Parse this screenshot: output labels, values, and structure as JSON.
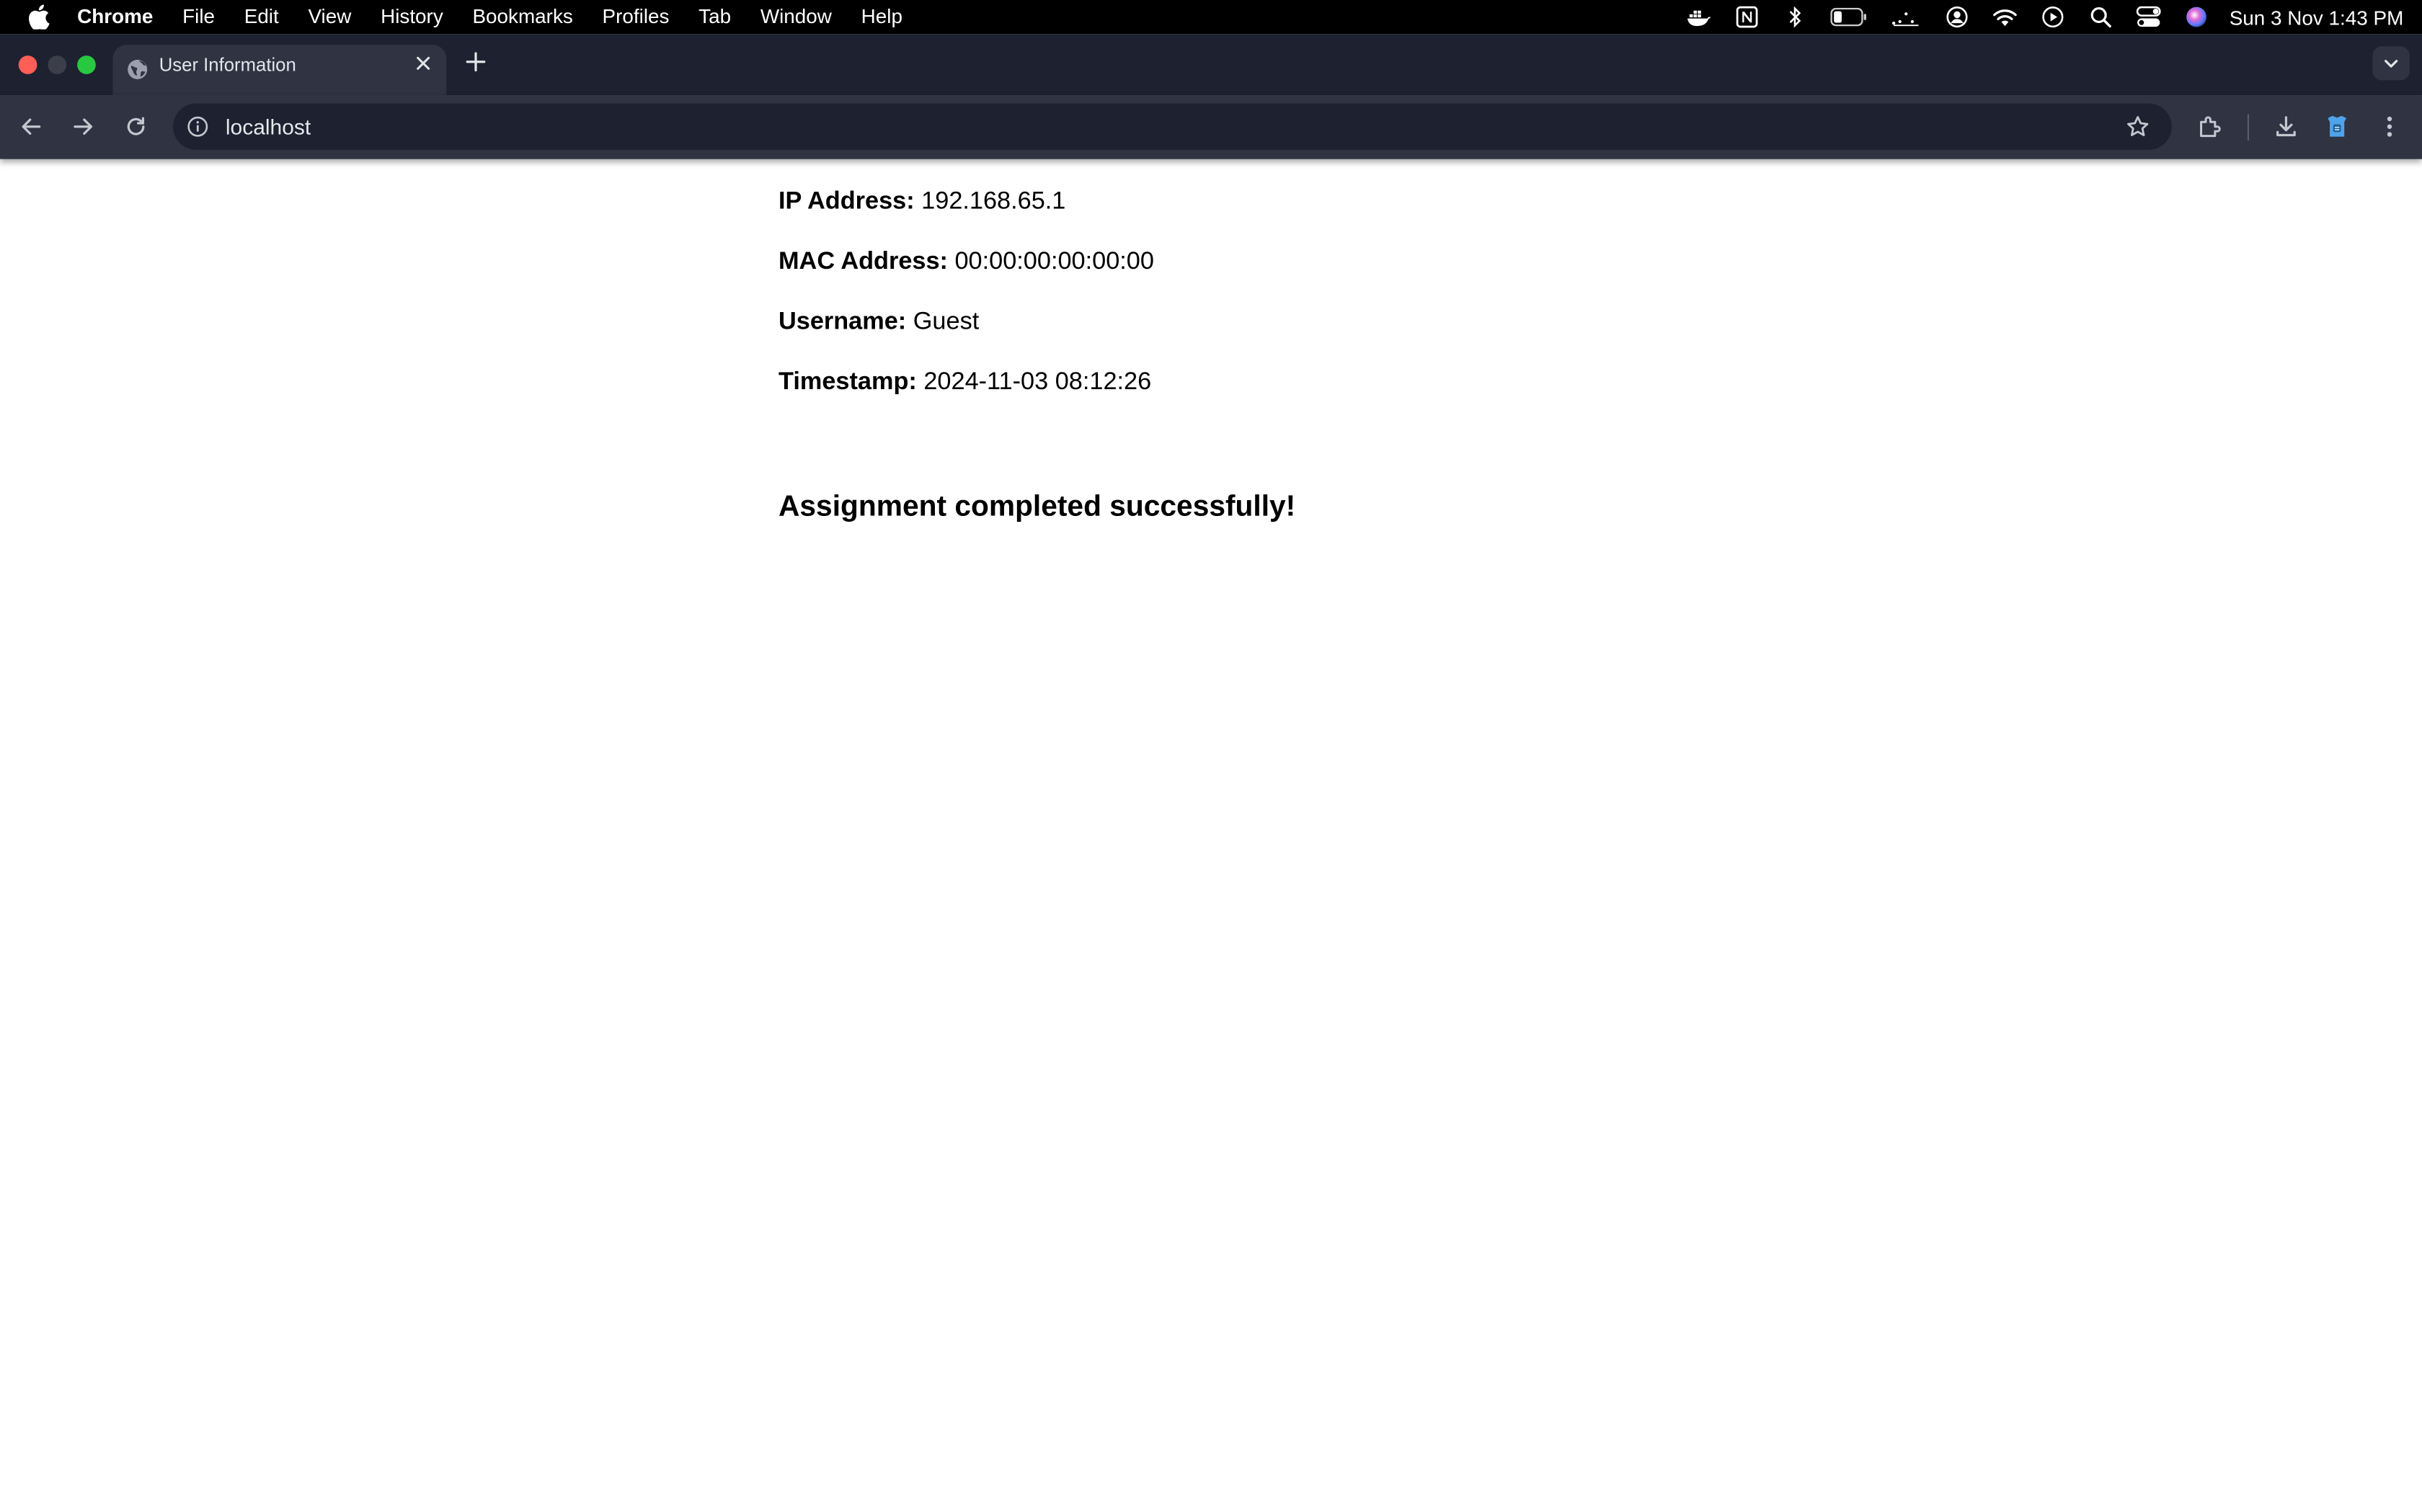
{
  "menubar": {
    "app_name": "Chrome",
    "items": [
      "File",
      "Edit",
      "View",
      "History",
      "Bookmarks",
      "Profiles",
      "Tab",
      "Window",
      "Help"
    ],
    "clock": "Sun 3 Nov  1:43 PM",
    "status_icons": [
      "docker-icon",
      "notion-icon",
      "bluetooth-icon",
      "battery-icon",
      "stage-manager-icon",
      "user-icon",
      "wifi-icon",
      "play-icon",
      "search-icon",
      "control-center-icon",
      "siri-icon"
    ]
  },
  "browser": {
    "tab_title": "User Information",
    "url": "localhost"
  },
  "page": {
    "ip_label": "IP Address:",
    "ip_value": "192.168.65.1",
    "mac_label": "MAC Address:",
    "mac_value": "00:00:00:00:00:00",
    "username_label": "Username:",
    "username_value": "Guest",
    "timestamp_label": "Timestamp:",
    "timestamp_value": "2024-11-03 08:12:26",
    "success_message": "Assignment completed successfully!"
  }
}
